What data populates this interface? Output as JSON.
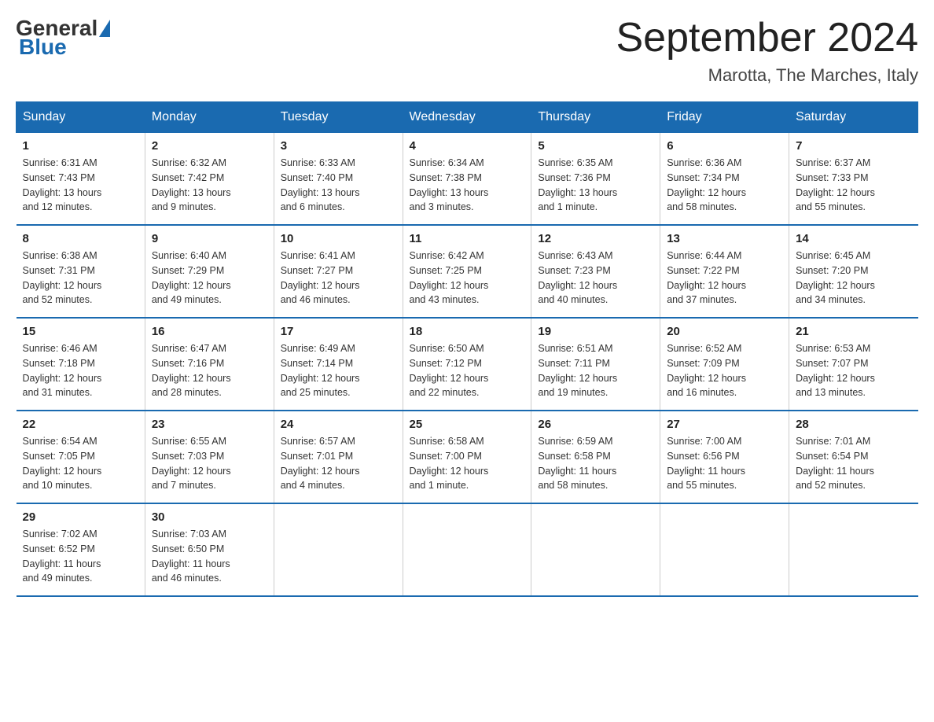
{
  "header": {
    "logo_general": "General",
    "logo_blue": "Blue",
    "month_year": "September 2024",
    "location": "Marotta, The Marches, Italy"
  },
  "weekdays": [
    "Sunday",
    "Monday",
    "Tuesday",
    "Wednesday",
    "Thursday",
    "Friday",
    "Saturday"
  ],
  "weeks": [
    [
      {
        "day": "1",
        "info": "Sunrise: 6:31 AM\nSunset: 7:43 PM\nDaylight: 13 hours\nand 12 minutes."
      },
      {
        "day": "2",
        "info": "Sunrise: 6:32 AM\nSunset: 7:42 PM\nDaylight: 13 hours\nand 9 minutes."
      },
      {
        "day": "3",
        "info": "Sunrise: 6:33 AM\nSunset: 7:40 PM\nDaylight: 13 hours\nand 6 minutes."
      },
      {
        "day": "4",
        "info": "Sunrise: 6:34 AM\nSunset: 7:38 PM\nDaylight: 13 hours\nand 3 minutes."
      },
      {
        "day": "5",
        "info": "Sunrise: 6:35 AM\nSunset: 7:36 PM\nDaylight: 13 hours\nand 1 minute."
      },
      {
        "day": "6",
        "info": "Sunrise: 6:36 AM\nSunset: 7:34 PM\nDaylight: 12 hours\nand 58 minutes."
      },
      {
        "day": "7",
        "info": "Sunrise: 6:37 AM\nSunset: 7:33 PM\nDaylight: 12 hours\nand 55 minutes."
      }
    ],
    [
      {
        "day": "8",
        "info": "Sunrise: 6:38 AM\nSunset: 7:31 PM\nDaylight: 12 hours\nand 52 minutes."
      },
      {
        "day": "9",
        "info": "Sunrise: 6:40 AM\nSunset: 7:29 PM\nDaylight: 12 hours\nand 49 minutes."
      },
      {
        "day": "10",
        "info": "Sunrise: 6:41 AM\nSunset: 7:27 PM\nDaylight: 12 hours\nand 46 minutes."
      },
      {
        "day": "11",
        "info": "Sunrise: 6:42 AM\nSunset: 7:25 PM\nDaylight: 12 hours\nand 43 minutes."
      },
      {
        "day": "12",
        "info": "Sunrise: 6:43 AM\nSunset: 7:23 PM\nDaylight: 12 hours\nand 40 minutes."
      },
      {
        "day": "13",
        "info": "Sunrise: 6:44 AM\nSunset: 7:22 PM\nDaylight: 12 hours\nand 37 minutes."
      },
      {
        "day": "14",
        "info": "Sunrise: 6:45 AM\nSunset: 7:20 PM\nDaylight: 12 hours\nand 34 minutes."
      }
    ],
    [
      {
        "day": "15",
        "info": "Sunrise: 6:46 AM\nSunset: 7:18 PM\nDaylight: 12 hours\nand 31 minutes."
      },
      {
        "day": "16",
        "info": "Sunrise: 6:47 AM\nSunset: 7:16 PM\nDaylight: 12 hours\nand 28 minutes."
      },
      {
        "day": "17",
        "info": "Sunrise: 6:49 AM\nSunset: 7:14 PM\nDaylight: 12 hours\nand 25 minutes."
      },
      {
        "day": "18",
        "info": "Sunrise: 6:50 AM\nSunset: 7:12 PM\nDaylight: 12 hours\nand 22 minutes."
      },
      {
        "day": "19",
        "info": "Sunrise: 6:51 AM\nSunset: 7:11 PM\nDaylight: 12 hours\nand 19 minutes."
      },
      {
        "day": "20",
        "info": "Sunrise: 6:52 AM\nSunset: 7:09 PM\nDaylight: 12 hours\nand 16 minutes."
      },
      {
        "day": "21",
        "info": "Sunrise: 6:53 AM\nSunset: 7:07 PM\nDaylight: 12 hours\nand 13 minutes."
      }
    ],
    [
      {
        "day": "22",
        "info": "Sunrise: 6:54 AM\nSunset: 7:05 PM\nDaylight: 12 hours\nand 10 minutes."
      },
      {
        "day": "23",
        "info": "Sunrise: 6:55 AM\nSunset: 7:03 PM\nDaylight: 12 hours\nand 7 minutes."
      },
      {
        "day": "24",
        "info": "Sunrise: 6:57 AM\nSunset: 7:01 PM\nDaylight: 12 hours\nand 4 minutes."
      },
      {
        "day": "25",
        "info": "Sunrise: 6:58 AM\nSunset: 7:00 PM\nDaylight: 12 hours\nand 1 minute."
      },
      {
        "day": "26",
        "info": "Sunrise: 6:59 AM\nSunset: 6:58 PM\nDaylight: 11 hours\nand 58 minutes."
      },
      {
        "day": "27",
        "info": "Sunrise: 7:00 AM\nSunset: 6:56 PM\nDaylight: 11 hours\nand 55 minutes."
      },
      {
        "day": "28",
        "info": "Sunrise: 7:01 AM\nSunset: 6:54 PM\nDaylight: 11 hours\nand 52 minutes."
      }
    ],
    [
      {
        "day": "29",
        "info": "Sunrise: 7:02 AM\nSunset: 6:52 PM\nDaylight: 11 hours\nand 49 minutes."
      },
      {
        "day": "30",
        "info": "Sunrise: 7:03 AM\nSunset: 6:50 PM\nDaylight: 11 hours\nand 46 minutes."
      },
      {
        "day": "",
        "info": ""
      },
      {
        "day": "",
        "info": ""
      },
      {
        "day": "",
        "info": ""
      },
      {
        "day": "",
        "info": ""
      },
      {
        "day": "",
        "info": ""
      }
    ]
  ]
}
